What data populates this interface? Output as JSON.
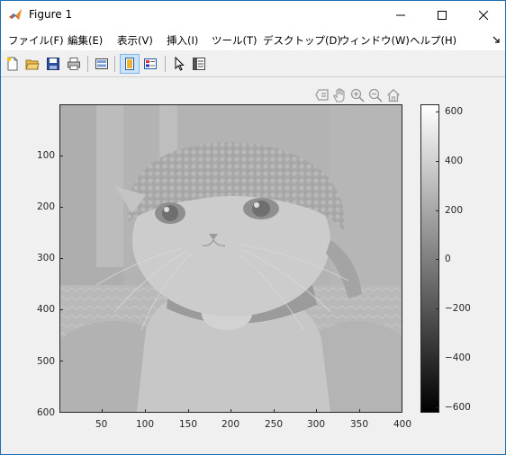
{
  "window": {
    "title": "Figure 1",
    "minimize_icon": "minimize-icon",
    "maximize_icon": "maximize-icon",
    "close_icon": "close-icon"
  },
  "menu": {
    "items": [
      {
        "label": "ファイル(F)"
      },
      {
        "label": "編集(E)"
      },
      {
        "label": "表示(V)"
      },
      {
        "label": "挿入(I)"
      },
      {
        "label": "ツール(T)"
      },
      {
        "label": "デスクトップ(D)"
      },
      {
        "label": "ウィンドウ(W)"
      },
      {
        "label": "ヘルプ(H)"
      }
    ]
  },
  "toolbar": {
    "buttons": [
      "new-figure-icon",
      "open-file-icon",
      "save-icon",
      "print-icon",
      "link-plot-icon",
      "hide-plot-tools-icon",
      "show-plot-tools-icon",
      "edit-plot-icon",
      "property-inspector-icon"
    ],
    "active": "hide-plot-tools-icon"
  },
  "axes_toolbar": {
    "buttons": [
      "data-tips-icon",
      "pan-icon",
      "zoom-in-icon",
      "zoom-out-icon",
      "home-icon"
    ]
  },
  "image_plot": {
    "content": "grayscale image of a kitten wearing a knitted hat",
    "x_ticks": [
      "50",
      "100",
      "150",
      "200",
      "250",
      "300",
      "350",
      "400"
    ],
    "y_ticks": [
      "100",
      "200",
      "300",
      "400",
      "500",
      "600"
    ],
    "xlim": [
      0.5,
      400.5
    ],
    "ylim": [
      0.5,
      600.5
    ]
  },
  "colorbar": {
    "ticks": [
      "600",
      "400",
      "200",
      "0",
      "−200",
      "−400",
      "−600"
    ],
    "range": [
      -650,
      650
    ],
    "colormap": "gray"
  }
}
